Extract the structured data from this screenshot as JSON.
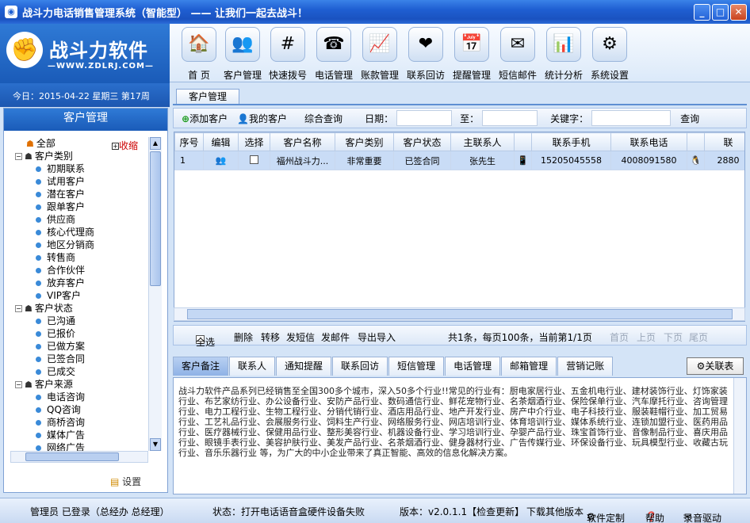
{
  "window": {
    "title": "战斗力电话销售管理系统（智能型）  —— 让我们一起去战斗！",
    "buttons": [
      "_",
      "□",
      "✕"
    ]
  },
  "brand": {
    "name": "战斗力软件",
    "url": "—WWW.ZDLRJ.COM—",
    "date_line": "今日：2015-04-22  星期三  第17周"
  },
  "toolbar": [
    {
      "label": "首 页",
      "icon": "house-icon",
      "glyph": "🏠"
    },
    {
      "label": "客户管理",
      "icon": "users-icon",
      "glyph": "👥"
    },
    {
      "label": "快速拨号",
      "icon": "keypad-icon",
      "glyph": "#"
    },
    {
      "label": "电话管理",
      "icon": "phone-icon",
      "glyph": "☎"
    },
    {
      "label": "账款管理",
      "icon": "chart-icon",
      "glyph": "📈"
    },
    {
      "label": "联系回访",
      "icon": "heart-icon",
      "glyph": "❤"
    },
    {
      "label": "提醒管理",
      "icon": "calendar-icon",
      "glyph": "📅"
    },
    {
      "label": "短信邮件",
      "icon": "mail-icon",
      "glyph": "✉"
    },
    {
      "label": "统计分析",
      "icon": "analysis-icon",
      "glyph": "📊"
    },
    {
      "label": "系统设置",
      "icon": "gear-icon",
      "glyph": "⚙"
    }
  ],
  "left": {
    "title": "客户管理",
    "collapse": "收缩",
    "settings": "设置",
    "tree": [
      {
        "label": "全部",
        "level": 0,
        "type": "root"
      },
      {
        "label": "客户类别",
        "level": 0,
        "type": "group"
      },
      {
        "label": "初期联系",
        "level": 1
      },
      {
        "label": "试用客户",
        "level": 1
      },
      {
        "label": "潜在客户",
        "level": 1
      },
      {
        "label": "跟单客户",
        "level": 1
      },
      {
        "label": "供应商",
        "level": 1
      },
      {
        "label": "核心代理商",
        "level": 1
      },
      {
        "label": "地区分销商",
        "level": 1
      },
      {
        "label": "转售商",
        "level": 1
      },
      {
        "label": "合作伙伴",
        "level": 1
      },
      {
        "label": "放弃客户",
        "level": 1
      },
      {
        "label": "VIP客户",
        "level": 1
      },
      {
        "label": "客户状态",
        "level": 0,
        "type": "group"
      },
      {
        "label": "已沟通",
        "level": 1
      },
      {
        "label": "已报价",
        "level": 1
      },
      {
        "label": "已做方案",
        "level": 1
      },
      {
        "label": "已签合同",
        "level": 1
      },
      {
        "label": "已成交",
        "level": 1
      },
      {
        "label": "客户来源",
        "level": 0,
        "type": "group"
      },
      {
        "label": "电话咨询",
        "level": 1
      },
      {
        "label": "QQ咨询",
        "level": 1
      },
      {
        "label": "商桥咨询",
        "level": 1
      },
      {
        "label": "媒体广告",
        "level": 1
      },
      {
        "label": "网络广告",
        "level": 1
      }
    ]
  },
  "main": {
    "tab": "客户管理",
    "filter": {
      "add": "添加客户",
      "mine": "我的客户",
      "query_all": "综合查询",
      "date_label": "日期：",
      "to_label": "至：",
      "keyword_label": "关键字：",
      "search": "查询"
    },
    "grid": {
      "columns": [
        "序号",
        "编辑",
        "选择",
        "客户名称",
        "客户类别",
        "客户状态",
        "主联系人",
        "",
        "联系手机",
        "联系电话",
        "",
        "联"
      ],
      "rows": [
        [
          "1",
          "",
          "",
          "福州战斗力...",
          "非常重要",
          "已签合同",
          "张先生",
          "",
          "15205045558",
          "4008091580",
          "",
          "2880"
        ]
      ]
    },
    "pager": {
      "select_all": "全选",
      "delete": "删除",
      "transfer": "转移",
      "sms": "发短信",
      "email": "发邮件",
      "import_export": "导出导入",
      "summary": "共1条，每页100条，当前第1/1页",
      "first": "首页",
      "prev": "上页",
      "next": "下页",
      "last": "尾页"
    },
    "bottom_tabs": [
      "客户备注",
      "联系人",
      "通知提醒",
      "联系回访",
      "短信管理",
      "电话管理",
      "邮箱管理",
      "营销记账"
    ],
    "close_label": "关联表",
    "note": "战斗力软件产品系列已经销售至全国300多个城市，深入50多个行业!!常见的行业有：厨电家居行业、五金机电行业、建材装饰行业、灯饰家装行业、布艺家纺行业、办公设备行业、安防产品行业、数码通信行业、鲜花宠物行业、名茶烟酒行业、保险保单行业、汽车摩托行业、咨询管理行业、电力工程行业、生物工程行业、分销代销行业、酒店用品行业、地产开发行业、房产中介行业、电子科技行业、服装鞋帽行业、加工贸易行业、工艺礼品行业、会展服务行业、饲料生产行业、网络服务行业、网店培训行业、体育培训行业、媒体系统行业、连锁加盟行业、医药用品行业、医疗器械行业、保健用品行业、整形美容行业、机器设备行业、学习培训行业、孕婴产品行业、珠宝首饰行业、音像制品行业、喜庆用品行业、眼镜手表行业、美容护肤行业、美发产品行业、名茶烟酒行业、健身器材行业、广告传媒行业、环保设备行业、玩具模型行业、收藏古玩行业、音乐乐器行业 等，为广大的中小企业带来了真正智能、高效的信息化解决方案。"
  },
  "status": {
    "user": "管理员  已登录（总经办 总经理）",
    "state": "状态：打开电话语音盒硬件设备失败",
    "version": "版本：v2.0.1.1【检查更新】",
    "download": "下载其他版本",
    "custom": "软件定制",
    "help": "帮助",
    "driver": "录音驱动"
  }
}
